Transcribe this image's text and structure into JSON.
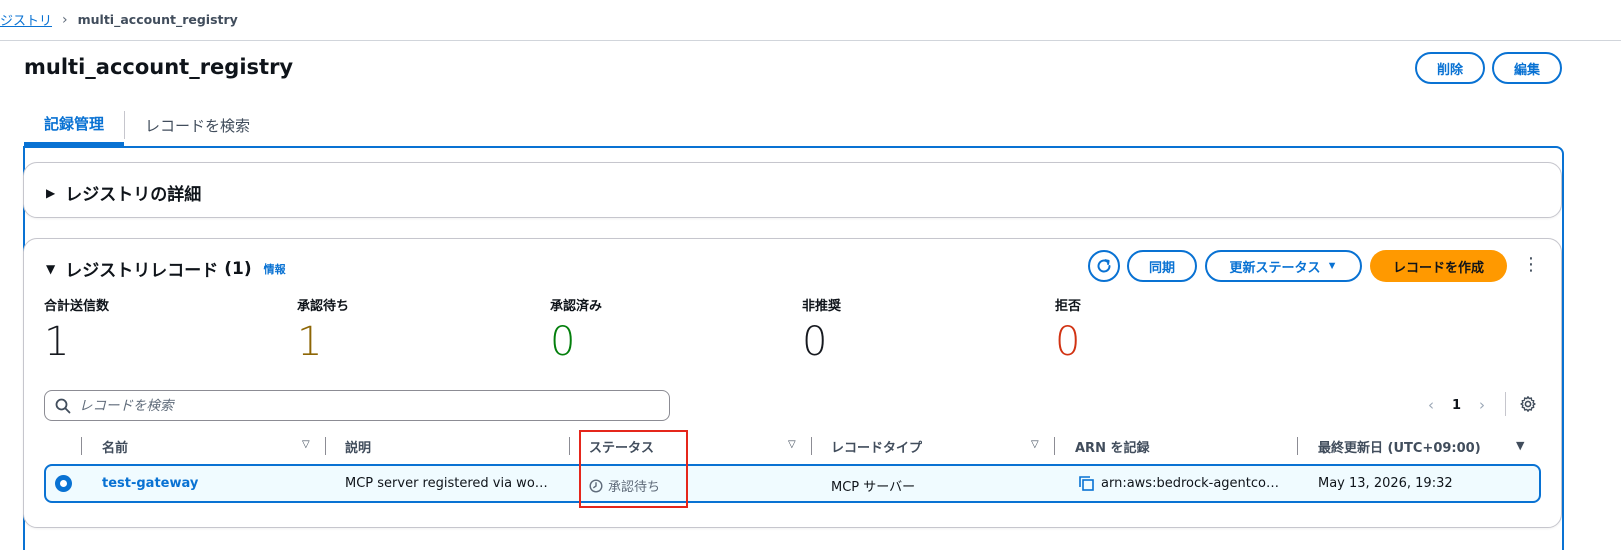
{
  "breadcrumb": {
    "parent": "ジストリ",
    "current": "multi_account_registry"
  },
  "page": {
    "title": "multi_account_registry"
  },
  "header_actions": {
    "delete": "削除",
    "edit": "編集"
  },
  "tabs": [
    {
      "label": "記録管理",
      "active": true
    },
    {
      "label": "レコードを検索",
      "active": false
    }
  ],
  "registry_details": {
    "title": "レジストリの詳細",
    "expanded": false
  },
  "records_panel": {
    "title": "レジストリレコード",
    "count": "(1)",
    "info": "情報",
    "actions": {
      "sync": "同期",
      "update_status": "更新ステータス",
      "create_record": "レコードを作成"
    }
  },
  "metrics": [
    {
      "label": "合計送信数",
      "value": "1",
      "color": "#16191f"
    },
    {
      "label": "承認待ち",
      "value": "1",
      "color": "#8d6605"
    },
    {
      "label": "承認済み",
      "value": "0",
      "color": "#037f0c"
    },
    {
      "label": "非推奨",
      "value": "0",
      "color": "#16191f"
    },
    {
      "label": "拒否",
      "value": "0",
      "color": "#d13212"
    }
  ],
  "search": {
    "placeholder": "レコードを検索",
    "value": ""
  },
  "pagination": {
    "current_page": "1"
  },
  "table": {
    "columns": [
      "名前",
      "説明",
      "ステータス",
      "レコードタイプ",
      "ARN を記録",
      "最終更新日 (UTC+09:00)"
    ],
    "rows": [
      {
        "selected": true,
        "name": "test-gateway",
        "description": "MCP server registered via work...",
        "status": "承認待ち",
        "record_type": "MCP サーバー",
        "arn": "arn:aws:bedrock-agentcor...",
        "updated": "May 13, 2026, 19:32"
      }
    ]
  },
  "icons": [
    "chevron-right-icon",
    "caret-right-icon",
    "caret-down-icon",
    "refresh-icon",
    "dropdown-caret-icon",
    "kebab-menu-icon",
    "search-icon",
    "chevron-left-icon",
    "settings-gear-icon",
    "sort-caret-icon",
    "clock-icon",
    "copy-icon"
  ],
  "colors": {
    "accent": "#0972d3",
    "primary_button": "#ff9900",
    "highlight": "#e5261b"
  }
}
